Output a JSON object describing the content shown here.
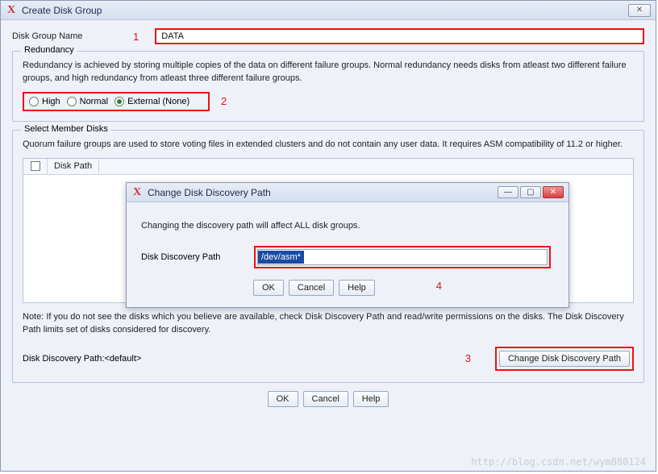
{
  "window": {
    "title": "Create Disk Group",
    "close_glyph": "✕"
  },
  "form": {
    "disk_group_name_label": "Disk Group Name",
    "disk_group_name_value": "DATA"
  },
  "redundancy": {
    "legend": "Redundancy",
    "description": "Redundancy is achieved by storing multiple copies of the data on different failure groups. Normal redundancy needs disks from atleast two different failure groups, and high redundancy from atleast three different failure groups.",
    "options": {
      "high": "High",
      "normal": "Normal",
      "external": "External (None)"
    },
    "selected": "external"
  },
  "member": {
    "legend": "Select Member Disks",
    "description": "Quorum failure groups are used to store voting files in extended clusters and do not contain any user data. It requires ASM compatibility of 11.2 or higher.",
    "columns": {
      "disk_path": "Disk Path"
    },
    "note": "Note: If you do not see the disks which you believe are available, check Disk Discovery Path and read/write permissions on the disks. The Disk Discovery Path limits set of disks considered for discovery.",
    "discovery_path_label": "Disk Discovery Path:<default>",
    "change_btn": "Change Disk Discovery Path"
  },
  "buttons": {
    "ok": "OK",
    "cancel": "Cancel",
    "help": "Help"
  },
  "modal": {
    "title": "Change Disk Discovery Path",
    "warning": "Changing the discovery path will affect ALL disk groups.",
    "field_label": "Disk Discovery Path",
    "field_value": "/dev/asm*",
    "buttons": {
      "ok": "OK",
      "cancel": "Cancel",
      "help": "Help"
    }
  },
  "annotations": {
    "a1": "1",
    "a2": "2",
    "a3": "3",
    "a4": "4"
  },
  "watermark": "http://blog.csdn.net/wym880124"
}
